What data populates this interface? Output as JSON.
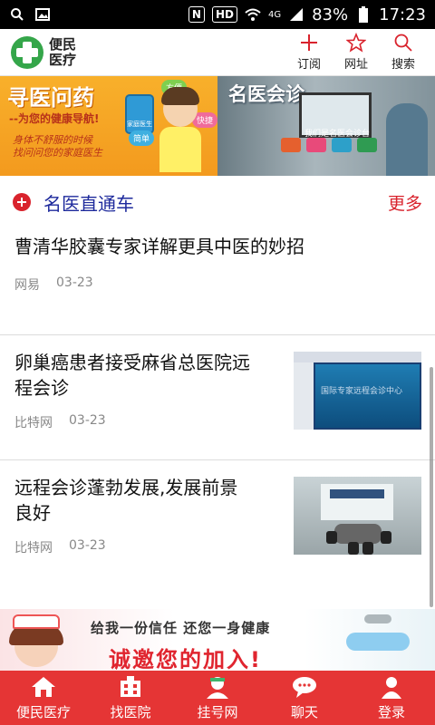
{
  "status_bar": {
    "nfc": "N",
    "hd": "HD",
    "network": "4G",
    "battery": "83%",
    "time": "17:23",
    "icons": [
      "search-icon",
      "image-icon",
      "nfc-icon",
      "wifi-icon",
      "signal-icon",
      "battery-icon"
    ]
  },
  "header": {
    "logo_line1": "便民",
    "logo_line2": "医疗",
    "actions": [
      {
        "label": "订阅",
        "icon": "plus-icon"
      },
      {
        "label": "网址",
        "icon": "star-icon"
      },
      {
        "label": "搜索",
        "icon": "search-icon"
      }
    ]
  },
  "banner": {
    "left": {
      "title": "寻医问药",
      "subtitle": "--为您的健康导航!",
      "line3": "身体不舒服的时候",
      "line4": "找问问您的家庭医生",
      "phone_label": "家庭医生",
      "bubbles": [
        "方便",
        "快捷",
        "简单"
      ]
    },
    "right": {
      "title": "名医会诊",
      "caption": "我们是名医会诊台"
    }
  },
  "section": {
    "title": "名医直通车",
    "more": "更多"
  },
  "news": [
    {
      "title": "曹清华胶囊专家详解更具中医的妙招",
      "source": "网易",
      "date": "03-23"
    },
    {
      "title_line1": "卵巢癌患者接受麻省总医院远",
      "title_line2": "程会诊",
      "source": "比特网",
      "date": "03-23",
      "thumb_text": "国际专家远程会诊中心"
    },
    {
      "title_line1": "远程会诊蓬勃发展,发展前景",
      "title_line2": "良好",
      "source": "比特网",
      "date": "03-23"
    }
  ],
  "ad": {
    "line1": "给我一份信任 还您一身健康",
    "line2": "诚邀您的加入!"
  },
  "tabs": [
    {
      "label": "便民医疗",
      "icon": "home-icon"
    },
    {
      "label": "找医院",
      "icon": "hospital-icon"
    },
    {
      "label": "挂号网",
      "icon": "doctor-icon"
    },
    {
      "label": "聊天",
      "icon": "chat-icon"
    },
    {
      "label": "登录",
      "icon": "user-icon"
    }
  ],
  "colors": {
    "accent_red": "#e53535",
    "section_blue": "#1e2a9c",
    "logo_green": "#35a64a"
  }
}
